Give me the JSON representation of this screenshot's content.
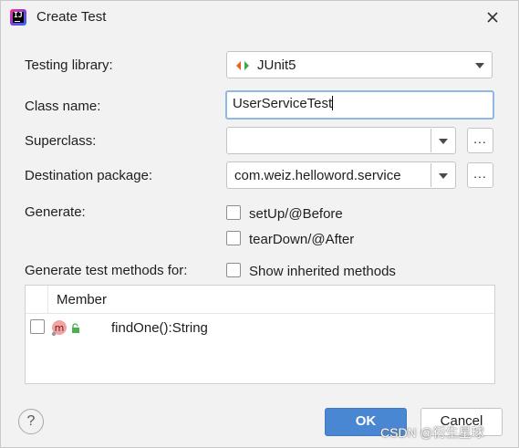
{
  "dialog": {
    "title": "Create Test",
    "app_icon_text": "IJ"
  },
  "fields": {
    "testing_library_label": "Testing library:",
    "testing_library_value": "JUnit5",
    "class_name_label": "Class name:",
    "class_name_value": "UserServiceTest",
    "superclass_label": "Superclass:",
    "superclass_value": "",
    "destination_label": "Destination package:",
    "destination_value": "com.weiz.helloword.service",
    "browse_label": "...",
    "generate_label": "Generate:",
    "setup_label": "setUp/@Before",
    "setup_checked": false,
    "teardown_label": "tearDown/@After",
    "teardown_checked": false,
    "methods_for_label": "Generate test methods for:",
    "show_inherited_label": "Show inherited methods",
    "show_inherited_checked": false
  },
  "members_table": {
    "column_header": "Member",
    "rows": [
      {
        "name": "findOne():String",
        "checked": false,
        "icon": "method-icon",
        "visibility": "public-lock-icon"
      }
    ]
  },
  "buttons": {
    "help": "?",
    "ok": "OK",
    "cancel": "Cancel"
  },
  "watermark": "CSDN @衍生星球",
  "colors": {
    "ok_button": "#4a87d2",
    "focus_border": "#8fb8e6",
    "method_icon": "#f4a3a3",
    "lock_icon": "#4caf50"
  }
}
